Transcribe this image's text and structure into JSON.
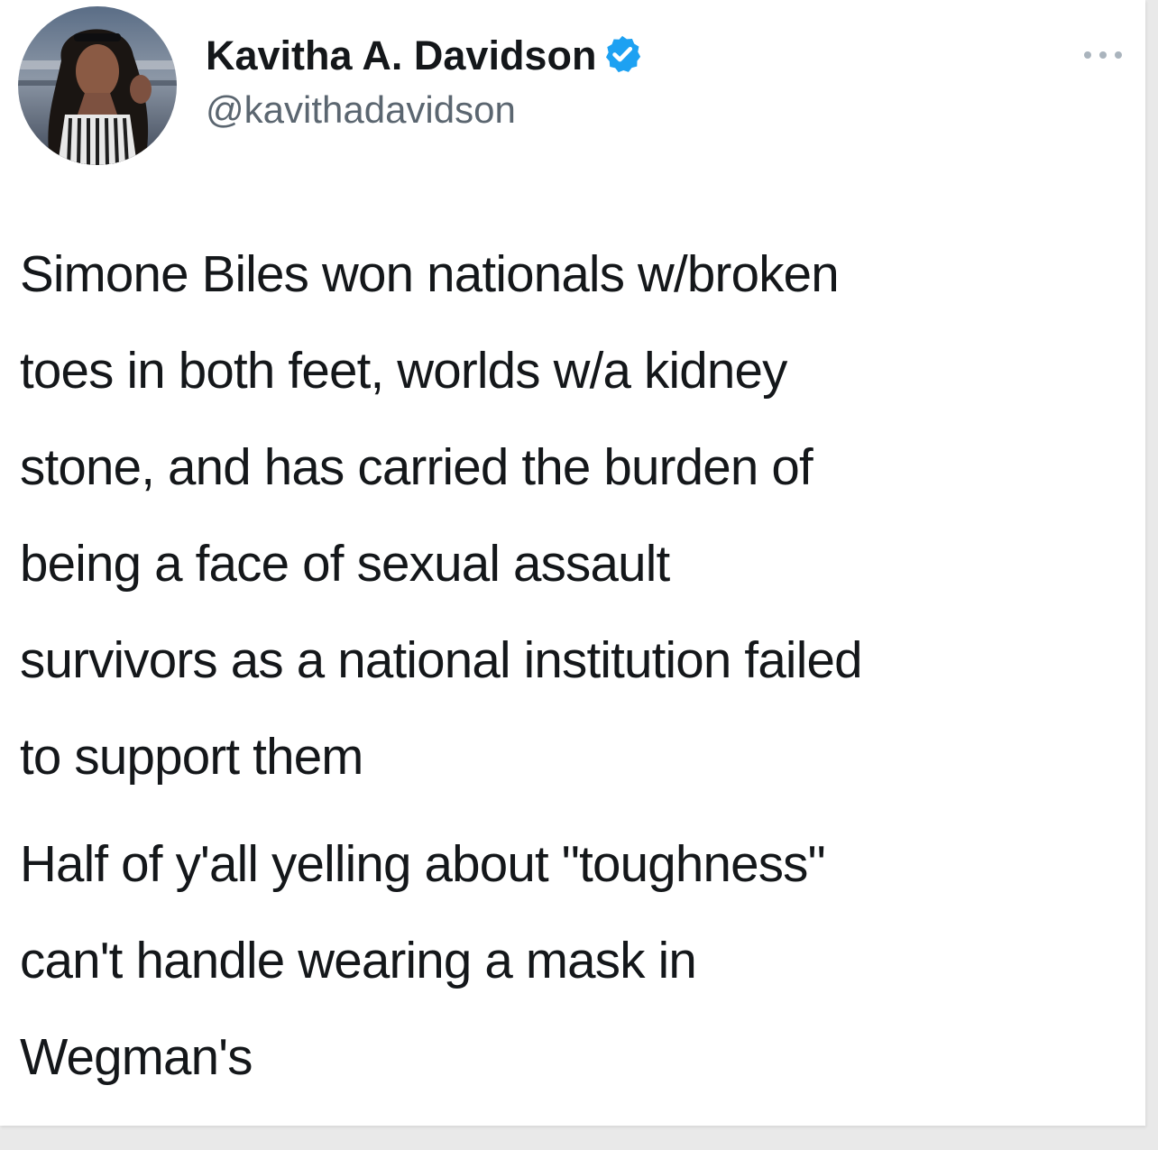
{
  "tweet": {
    "author": {
      "display_name": "Kavitha A. Davidson",
      "handle": "@kavithadavidson",
      "verified_icon": "verified-badge-icon",
      "avatar_icon": "profile-photo"
    },
    "more_icon": "more-options-icon",
    "paragraphs": [
      "Simone Biles won nationals w/broken\ntoes in both feet, worlds w/a kidney\nstone, and has carried the burden of\nbeing a face of sexual assault\nsurvivors as a national institution failed\nto support them",
      "Half of y'all yelling about \"toughness\"\ncan't handle wearing a mask in\nWegman's"
    ]
  },
  "colors": {
    "text": "#14171a",
    "secondary_text": "#5b6670",
    "verified_blue": "#1da1f2",
    "background": "#ffffff"
  }
}
